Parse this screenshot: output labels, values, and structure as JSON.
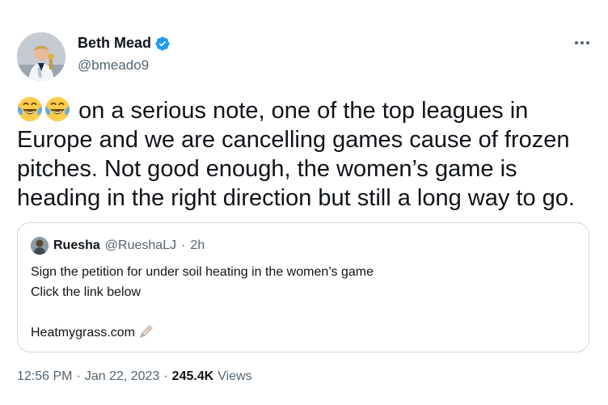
{
  "author": {
    "display_name": "Beth Mead",
    "handle": "@bmeado9",
    "verified": true
  },
  "more_icon": "more-dots-icon",
  "tweet_text": "on a serious note, one of the top leagues in Europe and we are cancelling games cause of frozen pitches. Not good enough, the women’s game is heading in the right direction but still a long way to go.",
  "tweet_emojis": [
    "face-with-tears-of-joy-emoji",
    "face-with-tears-of-joy-emoji"
  ],
  "quote": {
    "name": "Ruesha",
    "handle": "@RueshaLJ",
    "separator": "·",
    "time": "2h",
    "line1": "Sign the petition for under soil heating in the women’s game",
    "line2": "Click the link below",
    "link": "Heatmygrass.com",
    "link_emoji": "writing-hand-emoji"
  },
  "meta": {
    "time": "12:56 PM",
    "sep1": "·",
    "date": "Jan 22, 2023",
    "sep2": "·",
    "views_count": "245.4K",
    "views_label": "Views"
  },
  "colors": {
    "text": "#0f1419",
    "secondary": "#536471",
    "verified": "#1d9bf0",
    "border": "#cfd9de"
  }
}
